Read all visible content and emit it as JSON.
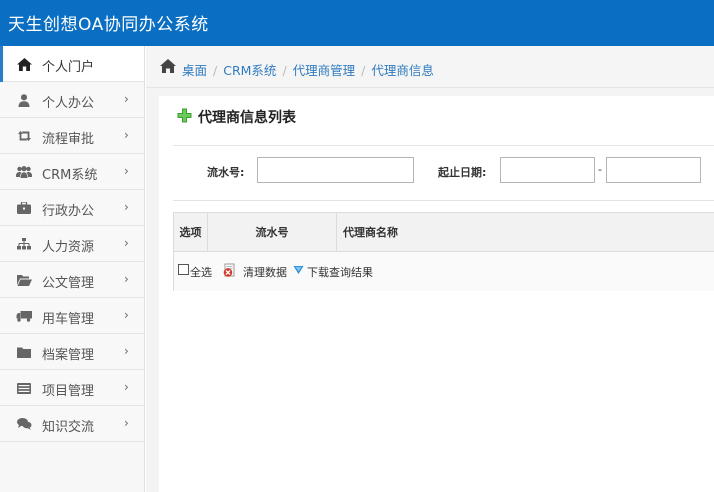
{
  "app": {
    "title": "天生创想OA协同办公系统"
  },
  "sidebar": {
    "items": [
      {
        "label": "个人门户",
        "icon": "home-icon",
        "active": true
      },
      {
        "label": "个人办公",
        "icon": "user-icon"
      },
      {
        "label": "流程审批",
        "icon": "retweet-icon"
      },
      {
        "label": "CRM系统",
        "icon": "group-icon"
      },
      {
        "label": "行政办公",
        "icon": "briefcase-icon"
      },
      {
        "label": "人力资源",
        "icon": "sitemap-icon"
      },
      {
        "label": "公文管理",
        "icon": "folder-open-icon"
      },
      {
        "label": "用车管理",
        "icon": "truck-icon"
      },
      {
        "label": "档案管理",
        "icon": "folder-icon"
      },
      {
        "label": "项目管理",
        "icon": "list-icon"
      },
      {
        "label": "知识交流",
        "icon": "comments-icon"
      }
    ],
    "chevron": "›"
  },
  "breadcrumb": {
    "items": [
      "桌面",
      "CRM系统",
      "代理商管理",
      "代理商信息"
    ],
    "separator": "/"
  },
  "panel": {
    "title": "代理商信息列表",
    "search": {
      "serial_label": "流水号:",
      "serial_value": "",
      "date_label": "起止日期:",
      "date_from": "",
      "date_to": "",
      "date_sep": "-"
    },
    "table": {
      "columns": [
        "选项",
        "流水号",
        "代理商名称"
      ]
    },
    "footer": {
      "select_all": "全选",
      "clear": "清理数据",
      "download": "下载查询结果"
    }
  },
  "colors": {
    "topbar": "#0a6fc2",
    "link": "#2f7bbf",
    "active_bar": "#2a7dc7"
  }
}
